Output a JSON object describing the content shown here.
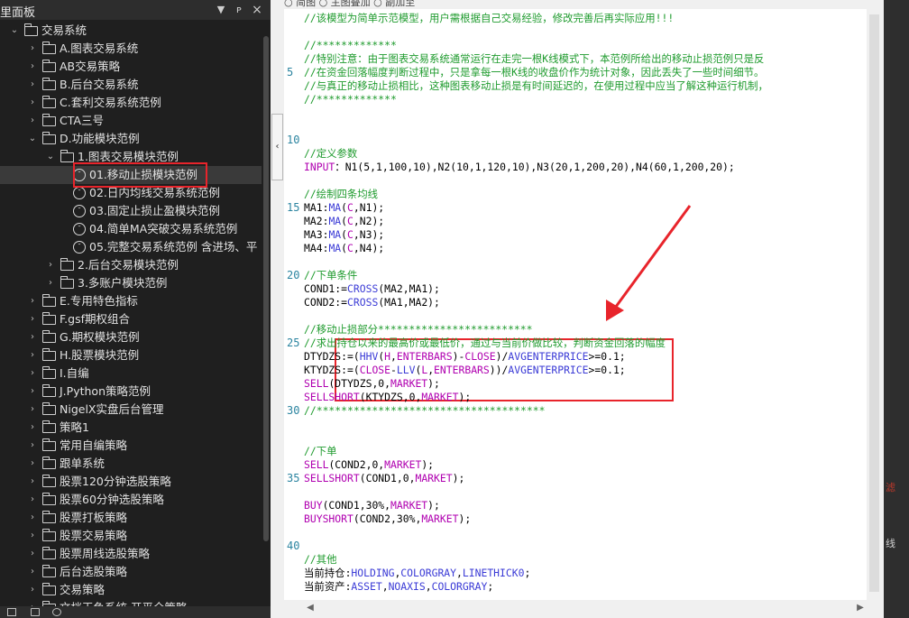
{
  "panel": {
    "title": "里面板",
    "pin_label": "ᴘ",
    "close_label": "×"
  },
  "tree": [
    {
      "label": "交易系统",
      "level": 0,
      "expanded": true,
      "kind": "folder"
    },
    {
      "label": "A.图表交易系统",
      "level": 1,
      "kind": "folder"
    },
    {
      "label": "AB交易策略",
      "level": 1,
      "kind": "folder"
    },
    {
      "label": "B.后台交易系统",
      "level": 1,
      "kind": "folder"
    },
    {
      "label": "C.套利交易系统范例",
      "level": 1,
      "kind": "folder"
    },
    {
      "label": "CTA三号",
      "level": 1,
      "kind": "folder"
    },
    {
      "label": "D.功能模块范例",
      "level": 1,
      "expanded": true,
      "kind": "folder"
    },
    {
      "label": "1.图表交易模块范例",
      "level": 2,
      "expanded": true,
      "kind": "folder"
    },
    {
      "label": "01.移动止损模块范例",
      "level": 3,
      "kind": "file",
      "selected": true
    },
    {
      "label": "02.日内均线交易系统范例",
      "level": 3,
      "kind": "file"
    },
    {
      "label": "03.固定止损止盈模块范例",
      "level": 3,
      "kind": "file"
    },
    {
      "label": "04.简单MA突破交易系统范例",
      "level": 3,
      "kind": "file"
    },
    {
      "label": "05.完整交易系统范例 含进场、平",
      "level": 3,
      "kind": "file"
    },
    {
      "label": "2.后台交易模块范例",
      "level": 2,
      "kind": "folder"
    },
    {
      "label": "3.多账户模块范例",
      "level": 2,
      "kind": "folder"
    },
    {
      "label": "E.专用特色指标",
      "level": 1,
      "kind": "folder"
    },
    {
      "label": "F.gsf期权组合",
      "level": 1,
      "kind": "folder"
    },
    {
      "label": "G.期权模块范例",
      "level": 1,
      "kind": "folder"
    },
    {
      "label": "H.股票模块范例",
      "level": 1,
      "kind": "folder"
    },
    {
      "label": "I.自编",
      "level": 1,
      "kind": "folder"
    },
    {
      "label": "J.Python策略范例",
      "level": 1,
      "kind": "folder"
    },
    {
      "label": "NigelX实盘后台管理",
      "level": 1,
      "kind": "folder"
    },
    {
      "label": "策略1",
      "level": 1,
      "kind": "folder"
    },
    {
      "label": "常用自编策略",
      "level": 1,
      "kind": "folder"
    },
    {
      "label": "跟单系统",
      "level": 1,
      "kind": "folder"
    },
    {
      "label": "股票120分钟选股策略",
      "level": 1,
      "kind": "folder"
    },
    {
      "label": "股票60分钟选股策略",
      "level": 1,
      "kind": "folder"
    },
    {
      "label": "股票打板策略",
      "level": 1,
      "kind": "folder"
    },
    {
      "label": "股票交易策略",
      "level": 1,
      "kind": "folder"
    },
    {
      "label": "股票周线选股策略",
      "level": 1,
      "kind": "folder"
    },
    {
      "label": "后台选股策略",
      "level": 1,
      "kind": "folder"
    },
    {
      "label": "交易策略",
      "level": 1,
      "kind": "folder"
    },
    {
      "label": "文档玉鱼系统 开平全策略",
      "level": 1,
      "kind": "folder"
    }
  ],
  "editor": {
    "toolbar_text": "○ 简图   ○ 主图叠加   ○ 副加至",
    "line_numbers": [
      {
        "n": "5",
        "row": 5
      },
      {
        "n": "10",
        "row": 10
      },
      {
        "n": "15",
        "row": 15
      },
      {
        "n": "20",
        "row": 20
      },
      {
        "n": "25",
        "row": 25
      },
      {
        "n": "30",
        "row": 30
      },
      {
        "n": "35",
        "row": 35
      },
      {
        "n": "40",
        "row": 40
      }
    ],
    "lines": [
      [
        [
          "cm",
          "//该模型为简单示范模型，用户需根据自己交易经验，修改完善后再实际应用!!!"
        ]
      ],
      [],
      [
        [
          "cm",
          "//*************"
        ]
      ],
      [
        [
          "cm",
          "//特别注意：由于图表交易系统通常运行在走完一根K线模式下，本范例所给出的移动止损范例只是反"
        ]
      ],
      [
        [
          "cm",
          "//在资金回落幅度判断过程中，只是拿每一根K线的收盘价作为统计对象，因此丢失了一些时间细节。"
        ]
      ],
      [
        [
          "cm",
          "//与真正的移动止损相比，这种图表移动止损是有时间延迟的，在使用过程中应当了解这种运行机制，"
        ]
      ],
      [
        [
          "cm",
          "//*************"
        ]
      ],
      [],
      [],
      [],
      [
        [
          "cm",
          "//定义参数"
        ]
      ],
      [
        [
          "mg",
          "INPUT"
        ],
        [
          "",
          "：N1(5,1,100,10),N2(10,1,120,10),N3(20,1,200,20),N4(60,1,200,20);"
        ]
      ],
      [],
      [
        [
          "cm",
          "//绘制四条均线"
        ]
      ],
      [
        [
          "",
          "MA1:"
        ],
        [
          "kw",
          "MA"
        ],
        [
          "",
          "("
        ],
        [
          "mg",
          "C"
        ],
        [
          "",
          ",N1);"
        ]
      ],
      [
        [
          "",
          "MA2:"
        ],
        [
          "kw",
          "MA"
        ],
        [
          "",
          "("
        ],
        [
          "mg",
          "C"
        ],
        [
          "",
          ",N2);"
        ]
      ],
      [
        [
          "",
          "MA3:"
        ],
        [
          "kw",
          "MA"
        ],
        [
          "",
          "("
        ],
        [
          "mg",
          "C"
        ],
        [
          "",
          ",N3);"
        ]
      ],
      [
        [
          "",
          "MA4:"
        ],
        [
          "kw",
          "MA"
        ],
        [
          "",
          "("
        ],
        [
          "mg",
          "C"
        ],
        [
          "",
          ",N4);"
        ]
      ],
      [],
      [
        [
          "cm",
          "//下单条件"
        ]
      ],
      [
        [
          "",
          "COND1:="
        ],
        [
          "kw",
          "CROSS"
        ],
        [
          "",
          "(MA2,MA1);"
        ]
      ],
      [
        [
          "",
          "COND2:="
        ],
        [
          "kw",
          "CROSS"
        ],
        [
          "",
          "(MA1,MA2);"
        ]
      ],
      [],
      [
        [
          "cm",
          "//移动止损部分*************************"
        ]
      ],
      [
        [
          "cm",
          "//求出持仓以来的最高价或最低价，通过与当前价做比较，判断资金回落的幅度"
        ]
      ],
      [
        [
          "",
          "DTYDZS:=("
        ],
        [
          "kw",
          "HHV"
        ],
        [
          "",
          "("
        ],
        [
          "mg",
          "H"
        ],
        [
          "",
          ","
        ],
        [
          "mg",
          "ENTERBARS"
        ],
        [
          "",
          ")-"
        ],
        [
          "mg",
          "CLOSE"
        ],
        [
          "",
          ")/"
        ],
        [
          "kw",
          "AVGENTERPRICE"
        ],
        [
          "",
          ">=0.1;"
        ]
      ],
      [
        [
          "",
          "KTYDZS:=("
        ],
        [
          "mg",
          "CLOSE"
        ],
        [
          "",
          "-"
        ],
        [
          "kw",
          "LLV"
        ],
        [
          "",
          "("
        ],
        [
          "mg",
          "L"
        ],
        [
          "",
          ","
        ],
        [
          "mg",
          "ENTERBARS"
        ],
        [
          "",
          "))/"
        ],
        [
          "kw",
          "AVGENTERPRICE"
        ],
        [
          "",
          ">=0.1;"
        ]
      ],
      [
        [
          "mg",
          "SELL"
        ],
        [
          "",
          "(DTYDZS,0,"
        ],
        [
          "mg",
          "MARKET"
        ],
        [
          "",
          ");"
        ]
      ],
      [
        [
          "mg",
          "SELLSHORT"
        ],
        [
          "",
          "(KTYDZS,0,"
        ],
        [
          "mg",
          "MARKET"
        ],
        [
          "",
          ");"
        ]
      ],
      [
        [
          "cm",
          "//*************************************"
        ]
      ],
      [],
      [],
      [
        [
          "cm",
          "//下单"
        ]
      ],
      [
        [
          "mg",
          "SELL"
        ],
        [
          "",
          "(COND2,0,"
        ],
        [
          "mg",
          "MARKET"
        ],
        [
          "",
          ");"
        ]
      ],
      [
        [
          "mg",
          "SELLSHORT"
        ],
        [
          "",
          "(COND1,0,"
        ],
        [
          "mg",
          "MARKET"
        ],
        [
          "",
          ");"
        ]
      ],
      [],
      [
        [
          "mg",
          "BUY"
        ],
        [
          "",
          "(COND1,30%,"
        ],
        [
          "mg",
          "MARKET"
        ],
        [
          "",
          ");"
        ]
      ],
      [
        [
          "mg",
          "BUYSHORT"
        ],
        [
          "",
          "(COND2,30%,"
        ],
        [
          "mg",
          "MARKET"
        ],
        [
          "",
          ");"
        ]
      ],
      [],
      [],
      [
        [
          "cm",
          "//其他"
        ]
      ],
      [
        [
          "",
          "当前持仓:"
        ],
        [
          "kw",
          "HOLDING"
        ],
        [
          "",
          ","
        ],
        [
          "kw",
          "COLORGRAY"
        ],
        [
          "",
          ","
        ],
        [
          "kw",
          "LINETHICK0"
        ],
        [
          "",
          ";"
        ]
      ],
      [
        [
          "",
          "当前资产:"
        ],
        [
          "kw",
          "ASSET"
        ],
        [
          "",
          ","
        ],
        [
          "kw",
          "NOAXIS"
        ],
        [
          "",
          ","
        ],
        [
          "kw",
          "COLORGRAY"
        ],
        [
          "",
          ";"
        ]
      ]
    ]
  },
  "right_edge": {
    "text_1": "滤",
    "text_2": "线"
  },
  "colors": {
    "highlight": "#e8242b",
    "comment": "#1f9b2e",
    "keyword": "#3b3bd6",
    "constant": "#b000b0"
  }
}
